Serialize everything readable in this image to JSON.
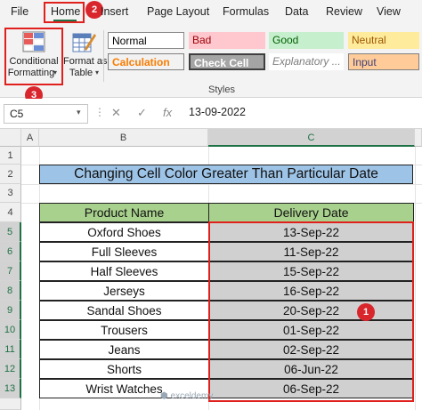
{
  "ribbon_tabs": [
    "File",
    "Home",
    "Insert",
    "Page Layout",
    "Formulas",
    "Data",
    "Review",
    "View"
  ],
  "ribbon": {
    "conditional_formatting_label": "Conditional",
    "conditional_formatting_label2": "Formatting",
    "format_as_table_label": "Format as",
    "format_as_table_label2": "Table",
    "styles_group_label": "Styles",
    "styles": {
      "normal": "Normal",
      "bad": "Bad",
      "good": "Good",
      "neutral": "Neutral",
      "calculation": "Calculation",
      "check_cell": "Check Cell",
      "explanatory": "Explanatory ...",
      "input": "Input"
    }
  },
  "badges": {
    "home": "2",
    "cf": "3",
    "range": "1"
  },
  "formula_bar": {
    "name_box": "C5",
    "cancel_symbol": "✕",
    "enter_symbol": "✓",
    "fx_symbol": "fx",
    "value": "13-09-2022"
  },
  "columns": [
    "A",
    "B",
    "C"
  ],
  "rows": [
    "1",
    "2",
    "3",
    "4",
    "5",
    "6",
    "7",
    "8",
    "9",
    "10",
    "11",
    "12",
    "13"
  ],
  "sheet": {
    "title": "Changing Cell Color Greater Than Particular Date",
    "headers": [
      "Product Name",
      "Delivery Date"
    ],
    "rows": [
      {
        "product": "Oxford Shoes",
        "date": "13-Sep-22"
      },
      {
        "product": "Full Sleeves",
        "date": "11-Sep-22"
      },
      {
        "product": "Half Sleeves",
        "date": "15-Sep-22"
      },
      {
        "product": "Jerseys",
        "date": "16-Sep-22"
      },
      {
        "product": "Sandal Shoes",
        "date": "20-Sep-22"
      },
      {
        "product": "Trousers",
        "date": "01-Sep-22"
      },
      {
        "product": "Jeans",
        "date": "02-Sep-22"
      },
      {
        "product": "Shorts",
        "date": "06-Jun-22"
      },
      {
        "product": "Wrist Watches",
        "date": "06-Sep-22"
      }
    ]
  },
  "watermark": "exceldemy",
  "colors": {
    "accent": "#1e7145",
    "highlight": "#e0201c",
    "title_fill": "#9dc3e6",
    "header_fill": "#a9d18e",
    "selected_fill": "#d0d0d0"
  },
  "icons": [
    "conditional-formatting-icon",
    "format-as-table-icon",
    "name-box-dropdown-icon",
    "cancel-icon",
    "enter-icon",
    "fx-icon"
  ]
}
